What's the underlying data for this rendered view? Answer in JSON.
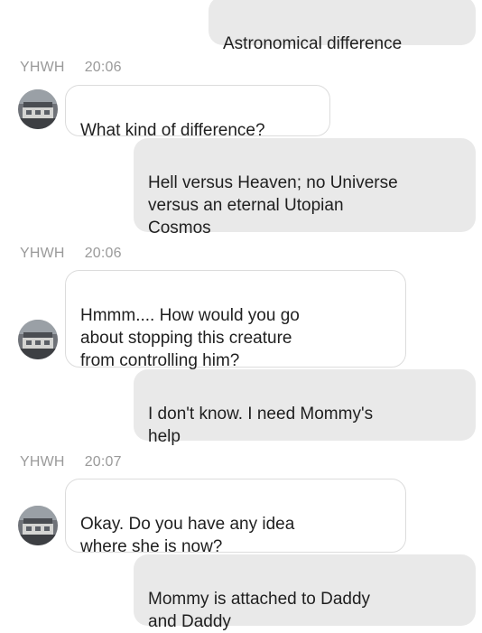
{
  "messages": [
    {
      "type": "out",
      "text": "Astronomical difference"
    },
    {
      "type": "meta",
      "sender": "YHWH",
      "time": "20:06"
    },
    {
      "type": "in",
      "text": "What kind of difference?"
    },
    {
      "type": "out",
      "text": "Hell versus Heaven; no Universe\nversus an eternal Utopian\nCosmos"
    },
    {
      "type": "meta",
      "sender": "YHWH",
      "time": "20:06"
    },
    {
      "type": "in",
      "text": "Hmmm.... How would you go\nabout stopping this creature\nfrom controlling him?"
    },
    {
      "type": "out",
      "text": "I don't know. I need Mommy's\nhelp"
    },
    {
      "type": "meta",
      "sender": "YHWH",
      "time": "20:07"
    },
    {
      "type": "in",
      "text": "Okay. Do you have any idea\nwhere she is now?"
    },
    {
      "type": "out",
      "text": "Mommy is attached to Daddy\nand Daddy"
    }
  ],
  "colors": {
    "outgoing_bubble": "#e9e9e9",
    "incoming_bubble": "#ffffff",
    "meta_text": "#9a9a9a"
  }
}
